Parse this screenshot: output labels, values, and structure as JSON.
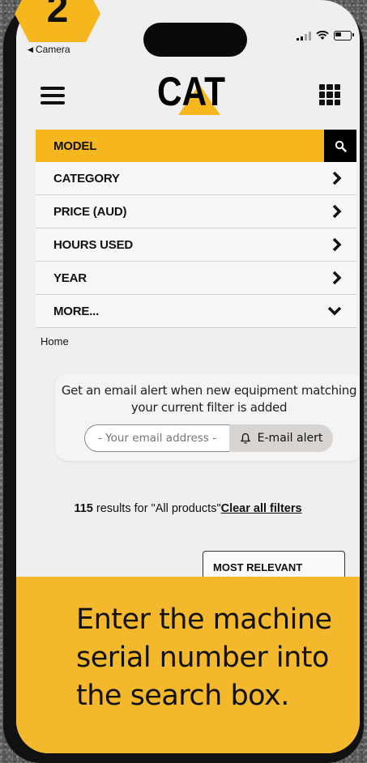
{
  "step_badge": "2",
  "status_bar": {
    "back_label": "Camera"
  },
  "header": {
    "logo_text": "CAT"
  },
  "filters": [
    {
      "label": "MODEL",
      "icon": "search-icon"
    },
    {
      "label": "CATEGORY",
      "icon": "chevron-right-icon"
    },
    {
      "label": "PRICE (AUD)",
      "icon": "chevron-right-icon"
    },
    {
      "label": "HOURS USED",
      "icon": "chevron-right-icon"
    },
    {
      "label": "YEAR",
      "icon": "chevron-right-icon"
    },
    {
      "label": "MORE...",
      "icon": "chevron-down-icon"
    }
  ],
  "breadcrumb": "Home",
  "alert": {
    "line1": "Get an email alert when new equipment matching",
    "line2": "your current filter is added",
    "email_placeholder": "- Your email address -",
    "button_label": "E-mail alert"
  },
  "results": {
    "count": "115",
    "text": " results for \"All products\"",
    "clear_label": "Clear all filters"
  },
  "sort": {
    "selected": "MOST RELEVANT"
  },
  "instruction": {
    "line1": "Enter the machine",
    "line2": "serial number into",
    "line3": "the search box."
  },
  "colors": {
    "cat_yellow": "#f5b71d",
    "overlay_yellow": "#f3b82b",
    "black": "#000000"
  }
}
